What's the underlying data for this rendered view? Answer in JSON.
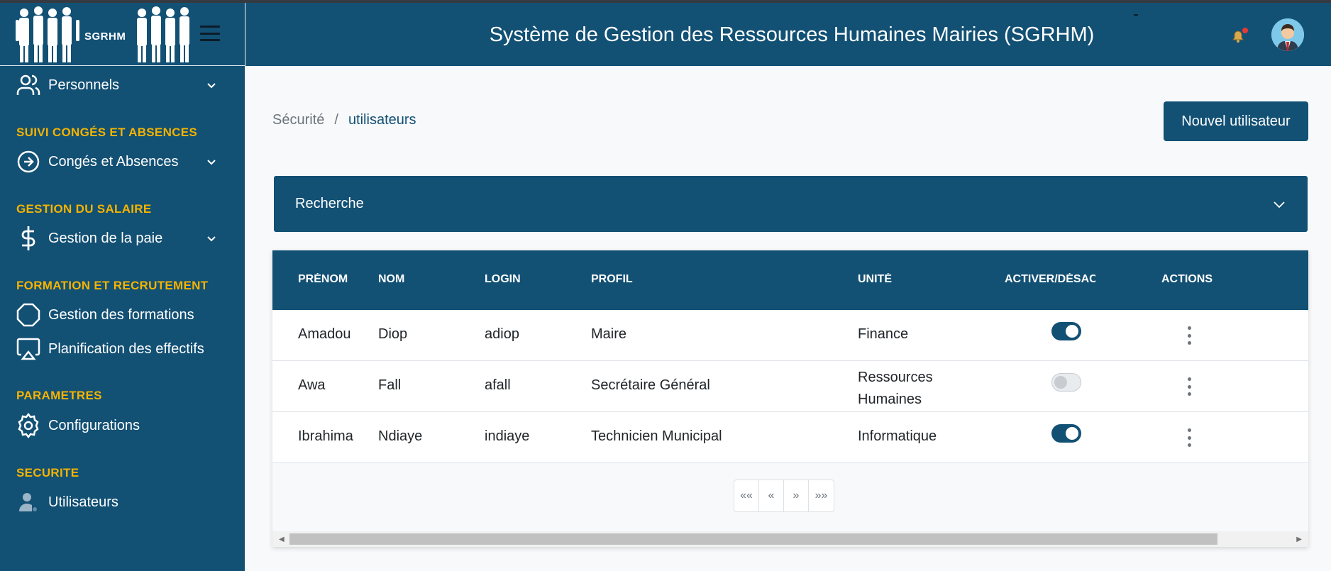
{
  "app": {
    "logo_text": "SGRHM",
    "title": "Système de Gestion des Ressources Humaines Mairies (SGRHM)"
  },
  "sidebar": {
    "items": [
      {
        "label": "Personnels",
        "icon": "users-icon"
      },
      {
        "section": "SUIVI CONGÉS ET ABSENCES"
      },
      {
        "label": "Congés et Absences",
        "icon": "arrow-circle-right-icon"
      },
      {
        "section": "GESTION DU SALAIRE"
      },
      {
        "label": "Gestion de la paie",
        "icon": "dollar-icon"
      },
      {
        "section": "FORMATION ET RECRUTEMENT"
      },
      {
        "label": "Gestion des formations",
        "icon": "octagon-icon"
      },
      {
        "label": "Planification des effectifs",
        "icon": "airplay-icon"
      },
      {
        "section": "PARAMETRES"
      },
      {
        "label": "Configurations",
        "icon": "gear-icon"
      },
      {
        "section": "SECURITE"
      },
      {
        "label": "Utilisateurs",
        "icon": "user-icon"
      }
    ]
  },
  "breadcrumb": {
    "parent": "Sécurité",
    "separator": "/",
    "current": "utilisateurs"
  },
  "actions": {
    "new_user_label": "Nouvel utilisateur"
  },
  "search": {
    "label": "Recherche"
  },
  "table": {
    "columns": [
      "PRÉNOM",
      "NOM",
      "LOGIN",
      "PROFIL",
      "UNITÉ",
      "ACTIVER/DÉSAC",
      "ACTIONS"
    ],
    "rows": [
      {
        "prenom": "Amadou",
        "nom": "Diop",
        "login": "adiop",
        "profil": "Maire",
        "unite": "Finance",
        "active": true
      },
      {
        "prenom": "Awa",
        "nom": "Fall",
        "login": "afall",
        "profil": "Secrétaire Général",
        "unite": "Ressources Humaines",
        "active": false
      },
      {
        "prenom": "Ibrahima",
        "nom": "Ndiaye",
        "login": "indiaye",
        "profil": "Technicien Municipal",
        "unite": "Informatique",
        "active": true
      }
    ]
  },
  "pagination": {
    "first": "««",
    "prev": "«",
    "next": "»",
    "last": "»»"
  },
  "colors": {
    "primary": "#125074",
    "section": "#f5b300",
    "background": "#f8f9fa"
  }
}
